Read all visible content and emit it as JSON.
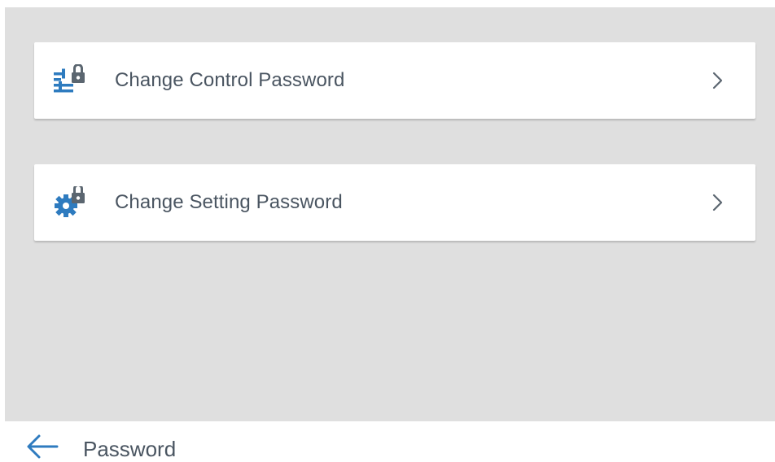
{
  "colors": {
    "accent": "#2e7bbf",
    "lock": "#5b6670",
    "background": "#dfdfdf",
    "card": "#ffffff",
    "text": "#4a5561"
  },
  "menu": {
    "items": [
      {
        "label": "Change Control Password",
        "icon": "sliders-lock-icon"
      },
      {
        "label": "Change Setting Password",
        "icon": "gear-lock-icon"
      }
    ]
  },
  "bottom_bar": {
    "back_icon": "arrow-left-icon",
    "title": "Password"
  }
}
